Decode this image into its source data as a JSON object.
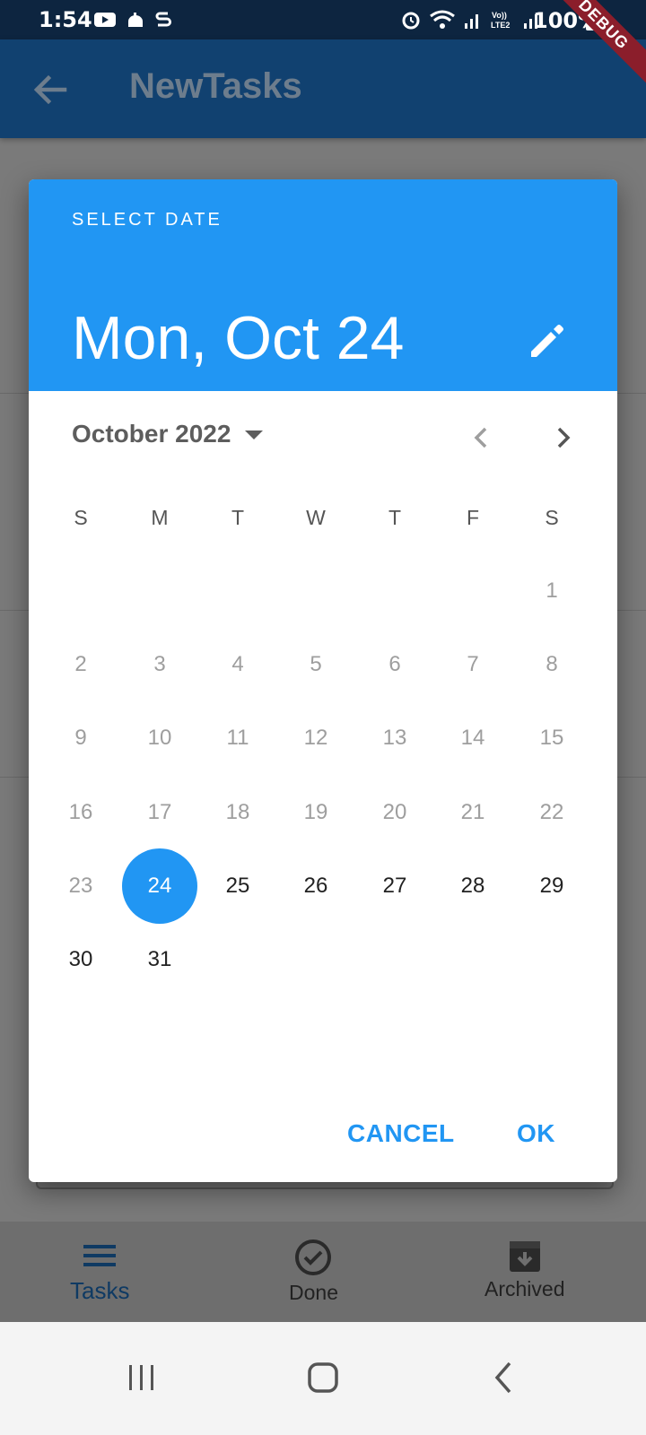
{
  "status_bar": {
    "time": "1:54",
    "battery": "100%",
    "debug_banner": "DEBUG"
  },
  "app_bar": {
    "title": "NewTasks"
  },
  "date_picker": {
    "header_label": "SELECT DATE",
    "selected_date_text": "Mon, Oct 24",
    "month_label": "October 2022",
    "weekdays": [
      "S",
      "M",
      "T",
      "W",
      "T",
      "F",
      "S"
    ],
    "days": [
      "1",
      "2",
      "3",
      "4",
      "5",
      "6",
      "7",
      "8",
      "9",
      "10",
      "11",
      "12",
      "13",
      "14",
      "15",
      "16",
      "17",
      "18",
      "19",
      "20",
      "21",
      "22",
      "23",
      "24",
      "25",
      "26",
      "27",
      "28",
      "29",
      "30",
      "31"
    ],
    "selected_day": "24",
    "first_enabled_day": "24",
    "cancel_label": "CANCEL",
    "ok_label": "OK",
    "accent_color": "#2196f3"
  },
  "bottom_nav": {
    "items": [
      {
        "label": "Tasks",
        "icon": "menu-icon",
        "active": true
      },
      {
        "label": "Done",
        "icon": "check-circle-icon",
        "active": false
      },
      {
        "label": "Archived",
        "icon": "archive-icon",
        "active": false
      }
    ]
  }
}
